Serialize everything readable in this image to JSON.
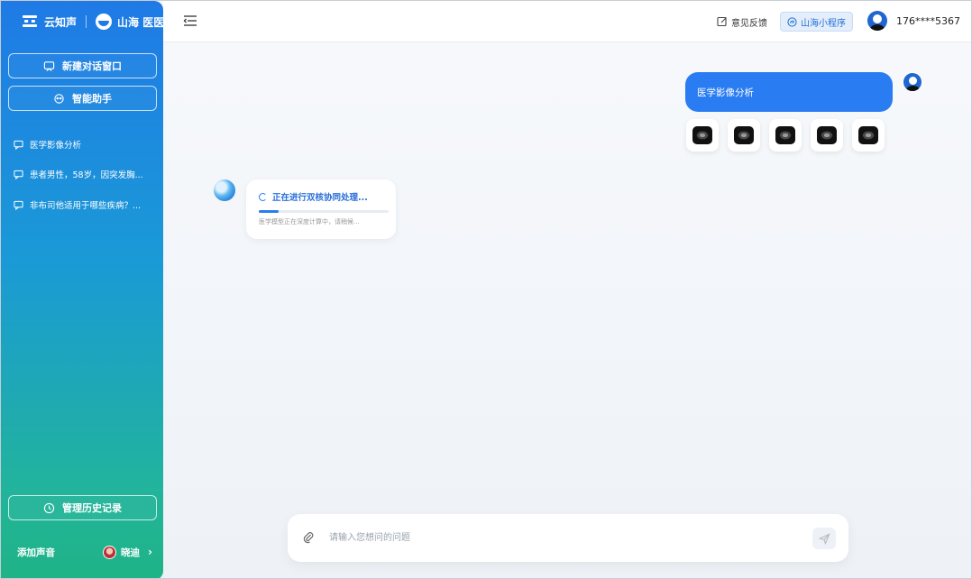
{
  "sidebar": {
    "brand": {
      "name_a": "云知声",
      "name_b": "山海 医医"
    },
    "new_chat_label": "新建对话窗口",
    "assistant_label": "智能助手",
    "history": [
      {
        "label": "医学影像分析"
      },
      {
        "label": "患者男性，58岁，因突发胸..."
      },
      {
        "label": "非布司他适用于哪些疾病？..."
      }
    ],
    "manage_history_label": "管理历史记录",
    "bottom_left_label": "添加声音",
    "bottom_user_label": "晓迪"
  },
  "header": {
    "feedback_label": "意见反馈",
    "mini_program_label": "山海小程序",
    "user_phone": "176****5367"
  },
  "chat": {
    "user_message": "医学影像分析",
    "thumbnail_count": 5,
    "bot_status_title": "正在进行双核协同处理...",
    "bot_status_sub": "医学模型正在深度计算中，请稍候...",
    "progress": 0.15
  },
  "input": {
    "placeholder": "请输入您想问的问题",
    "value": ""
  },
  "colors": {
    "accent": "#2a7cf2",
    "sidebar_top": "#1f7ae6",
    "sidebar_bottom": "#1fb386"
  },
  "icons": {
    "new_chat": "chat-window-icon",
    "assistant": "robot-icon",
    "history_item": "chat-bubble-icon",
    "manage_history": "clock-icon",
    "feedback": "edit-icon",
    "mini_program": "mini-program-icon",
    "attach": "paperclip-icon",
    "send": "send-icon"
  }
}
